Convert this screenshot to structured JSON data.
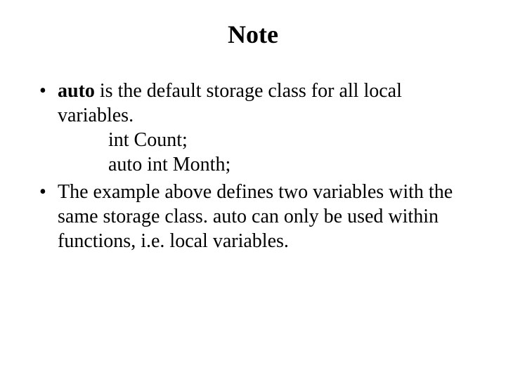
{
  "title": "Note",
  "bullets": [
    {
      "keyword": "auto",
      "rest": " is the default storage class for all local variables.",
      "code": [
        "int Count;",
        "auto int Month;"
      ]
    },
    {
      "text": "The example above defines two variables with the same storage class. auto can only be used within functions, i.e. local variables."
    }
  ]
}
